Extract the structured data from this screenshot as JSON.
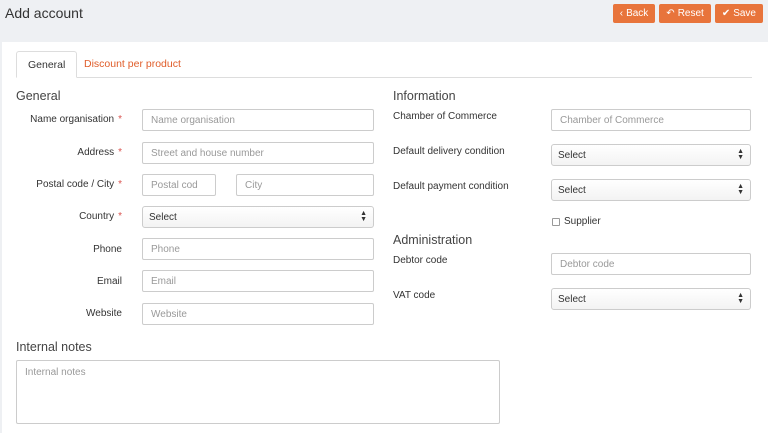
{
  "header": {
    "title": "Add account"
  },
  "toolbar": {
    "back_label": "Back",
    "back_icon": "‹",
    "reset_label": "Reset",
    "reset_icon": "↶",
    "save_label": "Save",
    "save_icon": "✔",
    "accent": "#e8743b"
  },
  "tabs": [
    {
      "label": "General"
    },
    {
      "label": "Discount per product"
    }
  ],
  "general": {
    "title": "General",
    "name_label": "Name organisation",
    "name_placeholder": "Name organisation",
    "address_label": "Address",
    "address_placeholder": "Street and house number",
    "postal_label": "Postal code / City",
    "postal_placeholder": "Postal cod",
    "city_placeholder": "City",
    "country_label": "Country",
    "country_value": "Select",
    "phone_label": "Phone",
    "phone_placeholder": "Phone",
    "email_label": "Email",
    "email_placeholder": "Email",
    "website_label": "Website",
    "website_placeholder": "Website",
    "required_mark": "*"
  },
  "information": {
    "title": "Information",
    "coc_label": "Chamber of Commerce",
    "coc_placeholder": "Chamber of Commerce",
    "delivery_label": "Default delivery condition",
    "delivery_value": "Select",
    "payment_label": "Default payment condition",
    "payment_value": "Select",
    "supplier_label": "Supplier"
  },
  "administration": {
    "title": "Administration",
    "debtor_label": "Debtor code",
    "debtor_placeholder": "Debtor code",
    "vat_label": "VAT code",
    "vat_value": "Select"
  },
  "notes": {
    "title": "Internal notes",
    "placeholder": "Internal notes"
  }
}
